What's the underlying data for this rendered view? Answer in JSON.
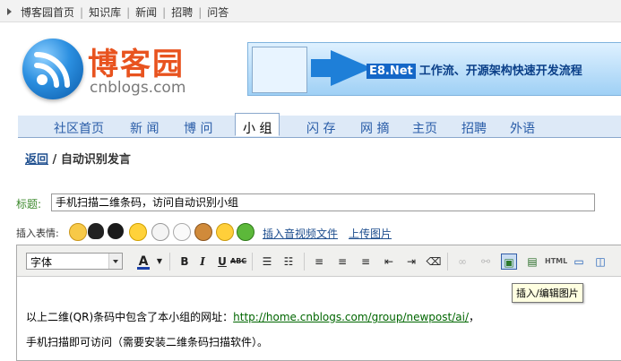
{
  "topbar": {
    "links": [
      "博客园首页",
      "知识库",
      "新闻",
      "招聘",
      "问答"
    ]
  },
  "brand": {
    "name_cn": "博客园",
    "name_en": "cnblogs.com"
  },
  "banner": {
    "brand": "E8.Net",
    "text": "工作流、开源架构快速开发流程"
  },
  "nav": {
    "tabs": [
      "社区首页",
      "新 闻",
      "博 问",
      "小 组",
      "闪 存",
      "网 摘",
      "主页",
      "招聘",
      "外语"
    ],
    "active_index": 3
  },
  "breadcrumb": {
    "back": "返回",
    "separator": "/",
    "current": "自动识别发言"
  },
  "form": {
    "title_label": "标题:",
    "title_value": "手机扫描二维条码，访问自动识别小组",
    "emoticon_label": "插入表情:",
    "insert_av": "插入音视频文件",
    "upload_image": "上传图片"
  },
  "toolbar": {
    "font_select": "字体",
    "bold": "B",
    "italic": "I",
    "underline": "U",
    "strike": "ABC",
    "html": "HTML",
    "tooltip": "插入/编辑图片"
  },
  "content": {
    "line1_prefix": "以上二维(QR)条码中包含了本小组的网址：",
    "line1_link": "http://home.cnblogs.com/group/newpost/ai/",
    "line1_suffix": "，",
    "line2": "手机扫描即可访问（需要安装二维条码扫描软件）。"
  },
  "colors": {
    "accent": "#e8531f",
    "link": "#1f4f8f",
    "nav_bg": "#dde9f7",
    "label_green": "#3d8a2e"
  }
}
